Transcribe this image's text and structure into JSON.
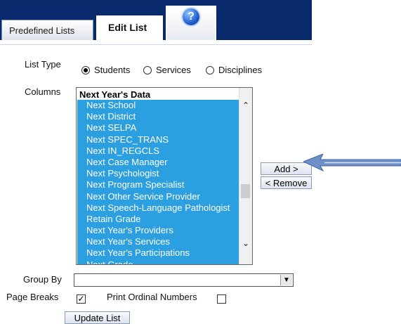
{
  "tabs": {
    "predefined": "Predefined Lists",
    "edit": "Edit List",
    "help_icon": "help-icon"
  },
  "form": {
    "list_type_label": "List Type",
    "list_type_options": [
      "Students",
      "Services",
      "Disciplines"
    ],
    "list_type_selected": "Students",
    "columns_label": "Columns",
    "columns_group_header": "Next Year's Data",
    "columns_items": [
      "Next School",
      "Next District",
      "Next SELPA",
      "Next SPEC_TRANS",
      "Next IN_REGCLS",
      "Next Case Manager",
      "Next Psychologist",
      "Next Program Specialist",
      "Next Other Service Provider",
      "Next Speech-Language Pathologist",
      "Retain Grade",
      "Next Year's Providers",
      "Next Year's Services",
      "Next Year's Participations",
      "Next Grade"
    ],
    "add_button": "Add >",
    "remove_button": "< Remove",
    "group_by_label": "Group By",
    "group_by_value": "",
    "page_breaks_label": "Page Breaks",
    "page_breaks_checked": true,
    "print_ordinal_label": "Print Ordinal Numbers",
    "print_ordinal_checked": false,
    "update_button": "Update List"
  },
  "colors": {
    "tab_band": "#0a2a6e",
    "selection": "#2c9fe0",
    "arrow": "#6f8fc9"
  }
}
